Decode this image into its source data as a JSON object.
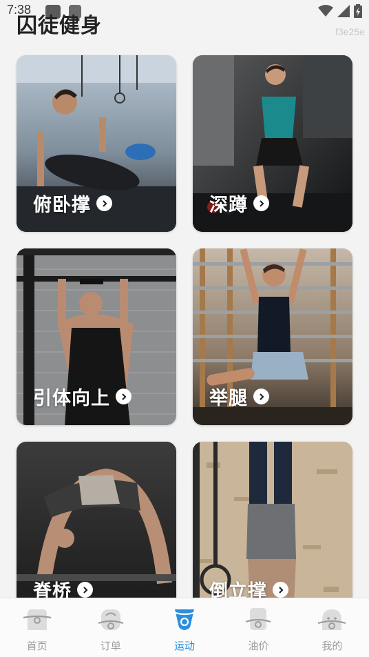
{
  "status_bar": {
    "time": "7:38",
    "icons": [
      "notification-icon",
      "notification-icon",
      "wifi-icon",
      "signal-icon",
      "battery-icon"
    ]
  },
  "header": {
    "title": "囚徒健身",
    "build_tag": "f3e25e"
  },
  "exercises": [
    {
      "label": "俯卧撑",
      "icon": "chevron-right-icon"
    },
    {
      "label": "深蹲",
      "icon": "chevron-right-icon"
    },
    {
      "label": "引体向上",
      "icon": "chevron-right-icon"
    },
    {
      "label": "举腿",
      "icon": "chevron-right-icon"
    },
    {
      "label": "脊桥",
      "icon": "chevron-right-icon"
    },
    {
      "label": "倒立撑",
      "icon": "chevron-right-icon"
    }
  ],
  "tabbar": {
    "active_color": "#2a8fe0",
    "inactive_color": "#9c9c9c",
    "items": [
      {
        "label": "首页",
        "icon": "home-icon"
      },
      {
        "label": "订单",
        "icon": "order-icon"
      },
      {
        "label": "运动",
        "icon": "sport-icon",
        "active": true
      },
      {
        "label": "油价",
        "icon": "fuel-icon"
      },
      {
        "label": "我的",
        "icon": "profile-icon"
      }
    ]
  }
}
